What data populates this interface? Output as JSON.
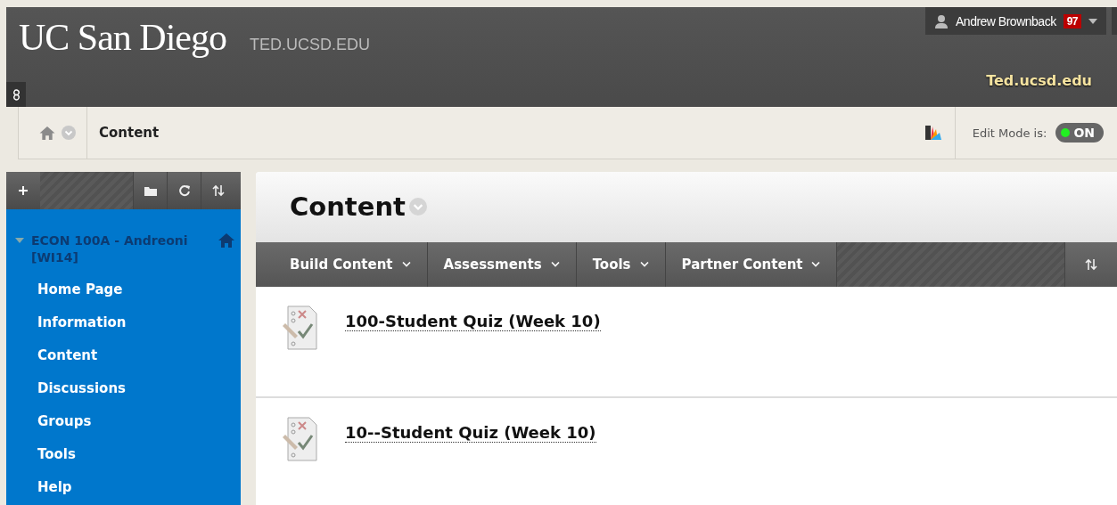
{
  "header": {
    "logo": "UC San Diego",
    "site": "TED.UCSD.EDU",
    "user": "Andrew Brownback",
    "notifications": "97",
    "tab": "Ted.ucsd.edu"
  },
  "breadcrumb": {
    "current": "Content"
  },
  "edit_mode": {
    "label": "Edit Mode is:",
    "on": true,
    "state_text": "ON"
  },
  "sidebar": {
    "course": {
      "title": "ECON 100A - Andreoni [WI14]",
      "expanded": true
    },
    "items": [
      {
        "label": "Home Page"
      },
      {
        "label": "Information"
      },
      {
        "label": "Content"
      },
      {
        "label": "Discussions"
      },
      {
        "label": "Groups"
      },
      {
        "label": "Tools"
      },
      {
        "label": "Help"
      }
    ]
  },
  "page": {
    "title": "Content",
    "actions": [
      {
        "label": "Build Content"
      },
      {
        "label": "Assessments"
      },
      {
        "label": "Tools"
      },
      {
        "label": "Partner Content"
      }
    ],
    "items": [
      {
        "title": "100-Student Quiz (Week 10)"
      },
      {
        "title": "10--Student Quiz (Week 10)"
      }
    ]
  }
}
